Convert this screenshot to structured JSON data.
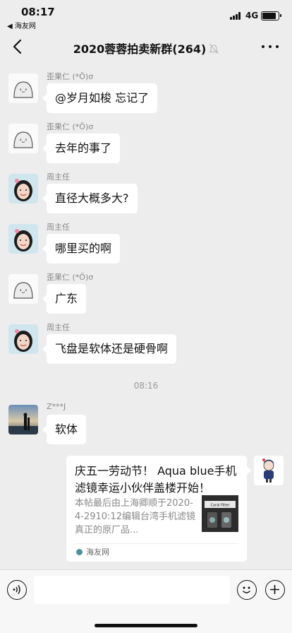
{
  "status": {
    "time": "08:17",
    "back_app": "◀ 海友网",
    "network": "4G"
  },
  "nav": {
    "title": "2020蓉蓉拍卖新群(264)",
    "back_icon": "chevron-left-icon",
    "mute_icon": "bell-muted-icon",
    "more_icon": "more-dots-icon"
  },
  "messages": [
    {
      "sender": "歪果仁 (*Ö)σ",
      "text": "@岁月如梭 忘记了",
      "avatar": "ghost-avatar"
    },
    {
      "sender": "歪果仁 (*Ö)σ",
      "text": "去年的事了",
      "avatar": "ghost-avatar"
    },
    {
      "sender": "周主任",
      "text": "直径大概多大?",
      "avatar": "girl-avatar"
    },
    {
      "sender": "周主任",
      "text": "哪里买的啊",
      "avatar": "girl-avatar"
    },
    {
      "sender": "歪果仁 (*Ö)σ",
      "text": "广东",
      "avatar": "ghost-avatar"
    },
    {
      "sender": "周主任",
      "text": "飞盘是软体还是硬骨啊",
      "avatar": "girl-avatar"
    }
  ],
  "timestamp": "08:16",
  "last_message": {
    "sender": "Z***J",
    "text": "软体"
  },
  "shared_link": {
    "title": "庆五一劳动节！ Aqua blue手机滤镜幸运小伙伴盖楼开始！",
    "description": "本帖最后由上海卿顺于2020-4-2910:12编辑台湾手机滤镜真正的原厂品...",
    "source": "海友网",
    "thumb_label": "Coral Filter"
  },
  "input": {
    "placeholder": ""
  },
  "colors": {
    "background": "#ededed",
    "bubble": "#ffffff",
    "meta_text": "#888888"
  }
}
